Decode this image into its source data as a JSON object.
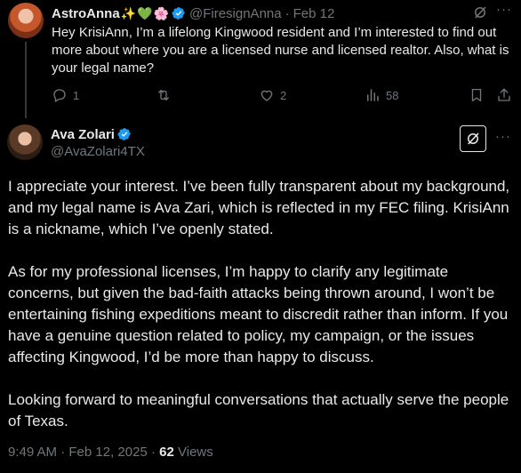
{
  "parent_tweet": {
    "display_name": "AstroAnna",
    "name_emojis": [
      "✨",
      "💚",
      "🌸"
    ],
    "handle": "@FiresignAnna",
    "separator": "·",
    "date": "Feb 12",
    "text": "Hey KrisiAnn, I’m a lifelong Kingwood resident and I’m interested to find out more about where you are a licensed nurse and licensed realtor. Also, what is your legal name?",
    "more_icon": "···",
    "actions": {
      "replies": "1",
      "reposts": "",
      "likes": "2",
      "views": "58"
    }
  },
  "main_tweet": {
    "display_name": "Ava Zolari",
    "handle": "@AvaZolari4TX",
    "more_icon": "···",
    "paragraphs": [
      "I appreciate your interest. I’ve been fully transparent about my background, and my legal name is Ava Zari, which is reflected in my FEC filing. KrisiAnn is a nickname, which I’ve openly stated.",
      "As for my professional licenses, I’m happy to clarify any legitimate concerns, but given the bad-faith attacks being thrown around, I won’t be entertaining fishing expeditions meant to discredit rather than inform. If you have a genuine question related to policy, my campaign, or the issues affecting Kingwood, I’d be more than happy to discuss.",
      "Looking forward to meaningful conversations that actually serve the people of Texas."
    ],
    "time": "9:49 AM",
    "separator": "·",
    "date": "Feb 12, 2025",
    "view_count": "62",
    "views_label": "Views"
  },
  "colors": {
    "background": "#000000",
    "text": "#e7e9ea",
    "secondary_text": "#71767b",
    "verified_badge": "#1d9bf0",
    "thread_line": "#333639"
  },
  "icons": [
    "reply-icon",
    "repost-icon",
    "like-icon",
    "views-icon",
    "bookmark-icon",
    "share-icon",
    "grok-icon",
    "verified-badge-icon",
    "more-icon"
  ]
}
